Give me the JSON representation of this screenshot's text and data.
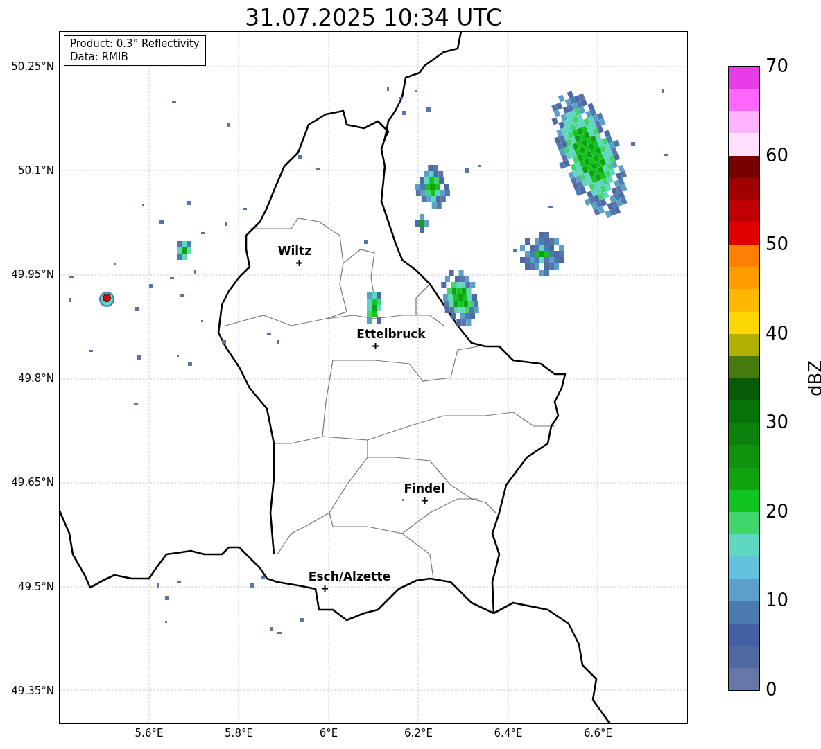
{
  "title": "31.07.2025 10:34 UTC",
  "map": {
    "info_box": [
      "Product: 0.3° Reflectivity",
      "Data: RMIB"
    ],
    "lat_ticks": [
      "50.25°N",
      "50.1°N",
      "49.95°N",
      "49.8°N",
      "49.65°N",
      "49.5°N",
      "49.35°N"
    ],
    "lon_ticks": [
      "5.6°E",
      "5.8°E",
      "6°E",
      "6.2°E",
      "6.4°E",
      "6.6°E"
    ],
    "places": [
      {
        "name": "Wiltz"
      },
      {
        "name": "Ettelbruck"
      },
      {
        "name": "Findel"
      },
      {
        "name": "Esch/Alzette"
      }
    ]
  },
  "colorbar": {
    "label": "dBZ",
    "ticks": [
      "70",
      "60",
      "50",
      "40",
      "30",
      "20",
      "10",
      "0"
    ],
    "segments": [
      {
        "color": "#e83ce8"
      },
      {
        "color": "#ff66ff"
      },
      {
        "color": "#ffb3ff"
      },
      {
        "color": "#ffe0ff"
      },
      {
        "color": "#7a0000"
      },
      {
        "color": "#a00000"
      },
      {
        "color": "#c00000"
      },
      {
        "color": "#e00000"
      },
      {
        "color": "#ff7f00"
      },
      {
        "color": "#ff9c00"
      },
      {
        "color": "#ffb700"
      },
      {
        "color": "#ffd700"
      },
      {
        "color": "#b0b000"
      },
      {
        "color": "#457a0c"
      },
      {
        "color": "#075a07"
      },
      {
        "color": "#077207"
      },
      {
        "color": "#0c820c"
      },
      {
        "color": "#0f930f"
      },
      {
        "color": "#10a310"
      },
      {
        "color": "#10c520"
      },
      {
        "color": "#3ed66a"
      },
      {
        "color": "#5fd6c0"
      },
      {
        "color": "#63c1dd"
      },
      {
        "color": "#5aa0c8"
      },
      {
        "color": "#4a7ab0"
      },
      {
        "color": "#4260a2"
      },
      {
        "color": "#5069a0"
      },
      {
        "color": "#6677a8"
      }
    ]
  }
}
